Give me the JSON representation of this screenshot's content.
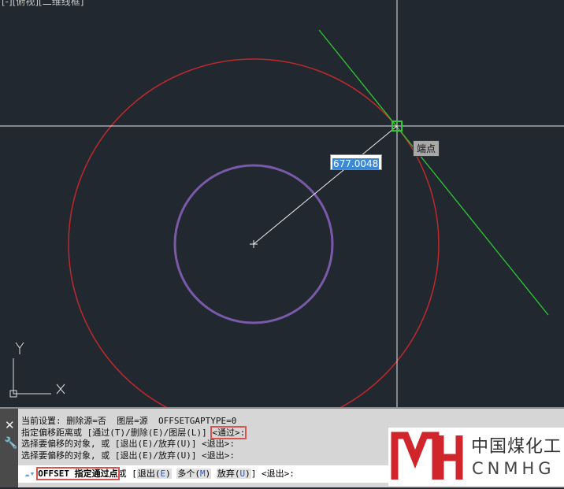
{
  "viewport": {
    "label": "[-][俯视][二维线框]",
    "dynamic_input": "677.0048",
    "snap_tooltip": "端点",
    "ucs": {
      "x": "X",
      "y": "Y"
    },
    "colors": {
      "background": "#212830",
      "outer_circle": "#c0282c",
      "inner_circle": "#7a5aa8",
      "line": "#2ecc2e"
    }
  },
  "command": {
    "history": [
      "当前设置: 删除源=否  图层=源  OFFSETGAPTYPE=0",
      "指定偏移距离或 [通过(T)/删除(E)/图层(L)] ",
      "选择要偏移的对象, 或 [退出(E)/放弃(U)] <退出>:",
      "选择要偏移的对象, 或 [退出(E)/放弃(U)] <退出>:"
    ],
    "highlight": "<通过>:",
    "prompt": "OFFSET 指定通过点",
    "prompt_tail": "或 [",
    "options": [
      {
        "label": "退出(",
        "key": "E",
        "end": ")"
      },
      {
        "label": "多个(",
        "key": "M",
        "end": ")"
      },
      {
        "label": "放弃(",
        "key": "U",
        "end": ")"
      }
    ],
    "suffix": "] <退出>:",
    "close": "✕",
    "settings": "🔧"
  },
  "watermark": {
    "cn": "中国煤化工",
    "en": "CNMHG",
    "mark": "MH"
  }
}
